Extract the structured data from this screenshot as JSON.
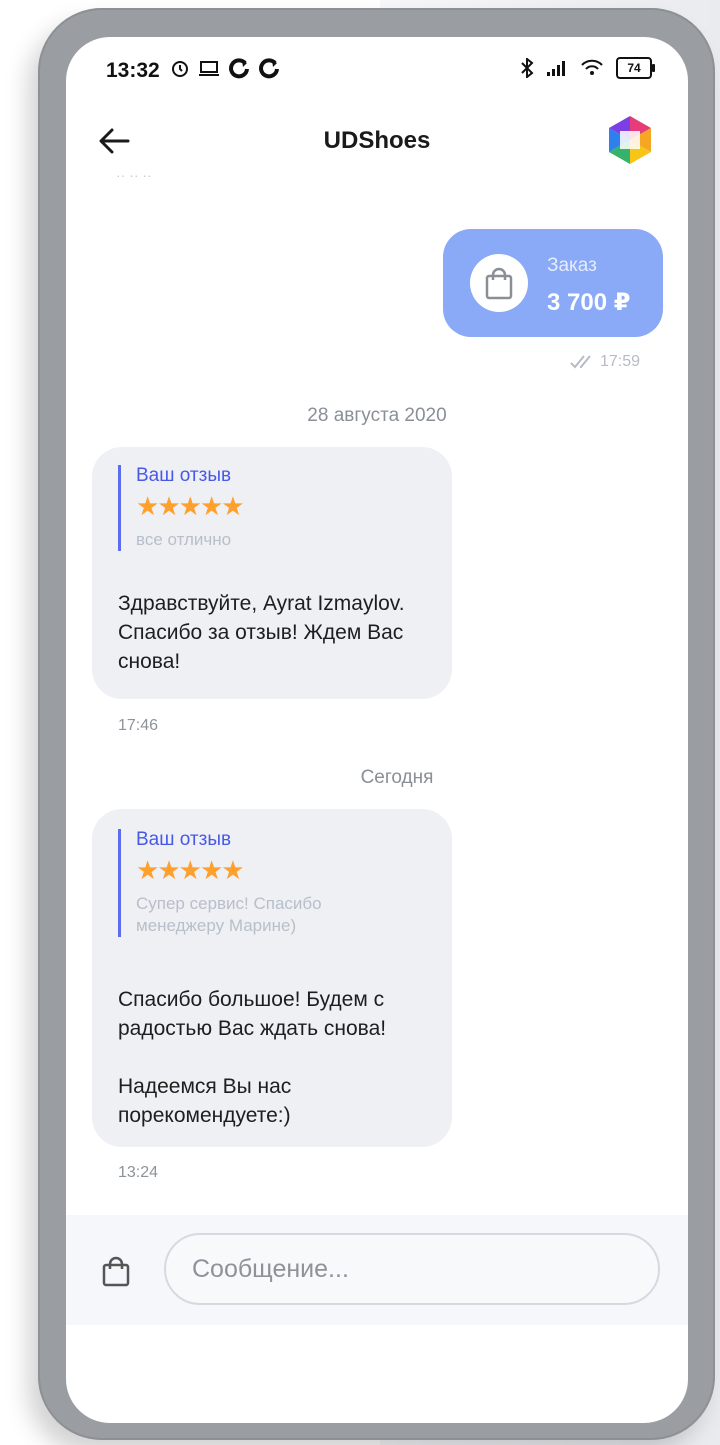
{
  "status_bar": {
    "time": "13:32",
    "battery": "74"
  },
  "header": {
    "title": "UDShoes"
  },
  "order": {
    "label": "Заказ",
    "amount": "3 700 ₽",
    "time": "17:59"
  },
  "messages": [
    {
      "date_separator": "28 августа 2020",
      "review_title": "Ваш отзыв",
      "stars": 5,
      "review_text": "все отлично",
      "reply": "Здравствуйте, Ayrat Izmaylov. Спасибо за отзыв! Ждем Вас снова!",
      "time": "17:46"
    },
    {
      "date_separator": "Сегодня",
      "review_title": "Ваш отзыв",
      "stars": 5,
      "review_text": "Супер сервис! Спасибо менеджеру Марине)",
      "reply": "Спасибо большое! Будем с радостью Вас ждать снова!\n\nНадеемся Вы нас порекомендуете:)",
      "time": "13:24"
    }
  ],
  "composer": {
    "placeholder": "Сообщение..."
  },
  "colors": {
    "order_bubble": "#8aa9f6",
    "accent": "#4859e6",
    "star": "#ff9f2d",
    "review_bubble": "#eef0f4"
  }
}
